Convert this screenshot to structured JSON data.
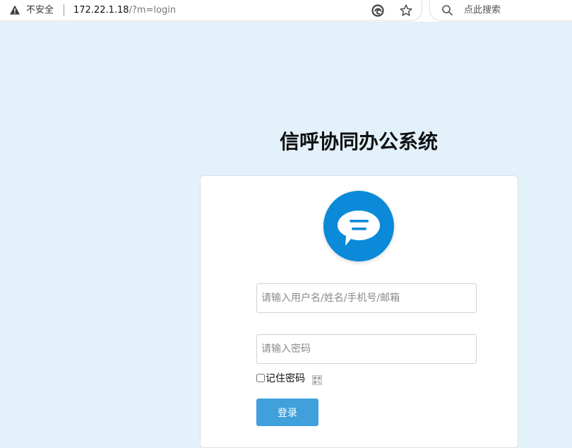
{
  "browser": {
    "security_label": "不安全",
    "url_host": "172.22.1.18",
    "url_path": "/?m=login",
    "search_placeholder": "点此搜索",
    "icons": [
      "warning-icon",
      "reader-mode-icon",
      "favorite-star-icon",
      "search-icon"
    ]
  },
  "page": {
    "title": "信呼协同办公系统",
    "background_color": "#e3f1fb",
    "accent_color": "#0a8ad9"
  },
  "login": {
    "logo_icon": "chat-bubble-icon",
    "username_placeholder": "请输入用户名/姓名/手机号/邮箱",
    "username_value": "",
    "password_placeholder": "请输入密码",
    "password_value": "",
    "remember_label": "记住密码",
    "remember_checked": false,
    "qr_icon": "qrcode-icon",
    "submit_label": "登录",
    "submit_color": "#40a0dc"
  }
}
